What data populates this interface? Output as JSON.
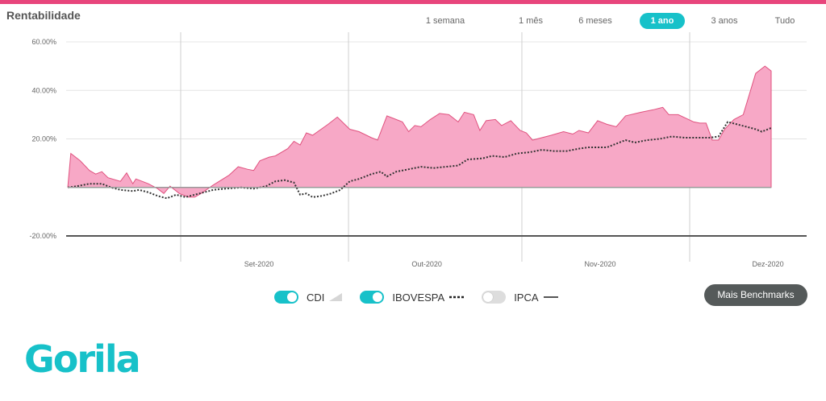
{
  "header": {
    "title": "Rentabilidade"
  },
  "periods": [
    {
      "label": "1 semana",
      "active": false
    },
    {
      "label": "1 mês",
      "active": false
    },
    {
      "label": "6 meses",
      "active": false
    },
    {
      "label": "1 ano",
      "active": true
    },
    {
      "label": "3 anos",
      "active": false
    },
    {
      "label": "Tudo",
      "active": false
    }
  ],
  "legend": {
    "cdi": {
      "label": "CDI",
      "enabled": true
    },
    "ibovespa": {
      "label": "IBOVESPA",
      "enabled": true
    },
    "ipca": {
      "label": "IPCA",
      "enabled": false
    }
  },
  "benchmarks_button": "Mais Benchmarks",
  "logo_text": "Gorila",
  "colors": {
    "accent": "#e8457c",
    "teal": "#17c1c9",
    "area_fill": "#f7a8c6",
    "area_stroke": "#e0527f",
    "dotted": "#333333"
  },
  "chart_data": {
    "type": "area",
    "x_range": [
      "2020-08-18",
      "2020-12-24"
    ],
    "x_ticks": [
      {
        "label": "Set-2020",
        "date": "2020-09-15"
      },
      {
        "label": "Out-2020",
        "date": "2020-10-15"
      },
      {
        "label": "Nov-2020",
        "date": "2020-11-15"
      },
      {
        "label": "Dez-2020",
        "date": "2020-12-15"
      }
    ],
    "ylim": [
      -20,
      60
    ],
    "y_ticks": [
      {
        "value": 60,
        "label": "60.00%"
      },
      {
        "value": 40,
        "label": "40.00%"
      },
      {
        "value": 20,
        "label": "20.00%"
      },
      {
        "value": -20,
        "label": "-20.00%"
      }
    ],
    "gridlines_dates": [
      "2020-09-01",
      "2020-10-01",
      "2020-11-01",
      "2020-12-01"
    ],
    "series": [
      {
        "name": "CDI",
        "style": "area",
        "points": [
          [
            "2020-08-18",
            0
          ],
          [
            "2020-08-19",
            14
          ],
          [
            "2020-08-22",
            11
          ],
          [
            "2020-08-25",
            7
          ],
          [
            "2020-08-27",
            5.5
          ],
          [
            "2020-08-29",
            6.5
          ],
          [
            "2020-08-31",
            4
          ],
          [
            "2020-09-04",
            2.5
          ],
          [
            "2020-09-06",
            6
          ],
          [
            "2020-09-08",
            1.5
          ],
          [
            "2020-09-09",
            3.5
          ],
          [
            "2020-09-13",
            1.5
          ],
          [
            "2020-09-16",
            -0.5
          ],
          [
            "2020-09-18",
            -2.5
          ],
          [
            "2020-09-20",
            0.5
          ],
          [
            "2020-09-23",
            -2.5
          ],
          [
            "2020-09-26",
            -4
          ],
          [
            "2020-09-28",
            -4
          ],
          [
            "2020-09-30",
            -2.5
          ],
          [
            "2020-10-04",
            1
          ],
          [
            "2020-10-09",
            5
          ],
          [
            "2020-10-12",
            8.5
          ],
          [
            "2020-10-15",
            7.5
          ],
          [
            "2020-10-17",
            7
          ],
          [
            "2020-10-19",
            11
          ],
          [
            "2020-10-22",
            12.5
          ],
          [
            "2020-10-24",
            13
          ],
          [
            "2020-10-28",
            16
          ],
          [
            "2020-10-30",
            19
          ],
          [
            "2020-11-01",
            17.5
          ],
          [
            "2020-11-03",
            22.5
          ],
          [
            "2020-11-05",
            21.5
          ],
          [
            "2020-11-10",
            26
          ],
          [
            "2020-11-13",
            29
          ],
          [
            "2020-11-17",
            24
          ],
          [
            "2020-11-20",
            23
          ],
          [
            "2020-11-24",
            20.5
          ],
          [
            "2020-11-26",
            19.5
          ],
          [
            "2020-11-29",
            29.5
          ],
          [
            "2020-12-01",
            28.5
          ],
          [
            "2020-12-04",
            27
          ],
          [
            "2020-12-06",
            23
          ],
          [
            "2020-12-08",
            25.5
          ],
          [
            "2020-12-10",
            25
          ],
          [
            "2020-12-13",
            28
          ],
          [
            "2020-12-16",
            30.5
          ],
          [
            "2020-12-19",
            30
          ],
          [
            "2020-12-22",
            27
          ],
          [
            "2020-12-24",
            31
          ],
          [
            "2020-12-27",
            30
          ],
          [
            "2020-12-29",
            23.5
          ],
          [
            "2020-12-31",
            27.5
          ],
          [
            "2021-01-03",
            28
          ],
          [
            "2021-01-05",
            25.5
          ],
          [
            "2021-01-08",
            27.5
          ],
          [
            "2021-01-11",
            23.5
          ],
          [
            "2021-01-13",
            22.5
          ],
          [
            "2021-01-15",
            19.5
          ],
          [
            "2021-01-18",
            20.5
          ],
          [
            "2021-01-21",
            21.5
          ],
          [
            "2021-01-25",
            23
          ],
          [
            "2021-01-28",
            22
          ],
          [
            "2021-01-30",
            23.5
          ],
          [
            "2021-02-02",
            22.5
          ],
          [
            "2021-02-05",
            27.5
          ],
          [
            "2021-02-08",
            26
          ],
          [
            "2021-02-11",
            25
          ],
          [
            "2021-02-14",
            29.5
          ],
          [
            "2021-02-19",
            31
          ],
          [
            "2021-02-23",
            32
          ],
          [
            "2021-02-26",
            33
          ],
          [
            "2021-02-28",
            30
          ],
          [
            "2021-03-03",
            30
          ],
          [
            "2021-03-08",
            27
          ],
          [
            "2021-03-10",
            26.5
          ],
          [
            "2021-03-12",
            26.5
          ],
          [
            "2021-03-14",
            19.5
          ],
          [
            "2021-03-16",
            19.5
          ],
          [
            "2021-03-18",
            24
          ],
          [
            "2021-03-21",
            28
          ],
          [
            "2021-03-24",
            30
          ],
          [
            "2021-03-28",
            47
          ],
          [
            "2021-03-31",
            50
          ],
          [
            "2021-04-02",
            48
          ]
        ]
      },
      {
        "name": "IBOVESPA",
        "style": "dotted",
        "points": [
          [
            "2020-08-18",
            0
          ],
          [
            "2020-08-21",
            0.5
          ],
          [
            "2020-08-25",
            1.5
          ],
          [
            "2020-08-29",
            1.5
          ],
          [
            "2020-09-01",
            0
          ],
          [
            "2020-09-04",
            -1
          ],
          [
            "2020-09-08",
            -1.5
          ],
          [
            "2020-09-10",
            -1
          ],
          [
            "2020-09-13",
            -2
          ],
          [
            "2020-09-16",
            -3.5
          ],
          [
            "2020-09-19",
            -4.5
          ],
          [
            "2020-09-22",
            -3
          ],
          [
            "2020-09-25",
            -4
          ],
          [
            "2020-09-28",
            -3
          ],
          [
            "2020-10-01",
            -2
          ],
          [
            "2020-10-04",
            -1
          ],
          [
            "2020-10-08",
            -0.5
          ],
          [
            "2020-10-13",
            0
          ],
          [
            "2020-10-17",
            -0.5
          ],
          [
            "2020-10-21",
            0.5
          ],
          [
            "2020-10-24",
            2.5
          ],
          [
            "2020-10-27",
            3
          ],
          [
            "2020-10-30",
            2
          ],
          [
            "2020-11-01",
            -3
          ],
          [
            "2020-11-03",
            -2.5
          ],
          [
            "2020-11-05",
            -4
          ],
          [
            "2020-11-08",
            -3.5
          ],
          [
            "2020-11-11",
            -2.5
          ],
          [
            "2020-11-14",
            -1
          ],
          [
            "2020-11-17",
            2.5
          ],
          [
            "2020-11-20",
            3.5
          ],
          [
            "2020-11-24",
            5.5
          ],
          [
            "2020-11-27",
            6.5
          ],
          [
            "2020-11-29",
            4.5
          ],
          [
            "2020-12-02",
            6.5
          ],
          [
            "2020-12-06",
            7.5
          ],
          [
            "2020-12-10",
            8.5
          ],
          [
            "2020-12-14",
            8
          ],
          [
            "2020-12-18",
            8.5
          ],
          [
            "2020-12-22",
            9
          ],
          [
            "2020-12-25",
            11.5
          ],
          [
            "2020-12-30",
            12
          ],
          [
            "2021-01-02",
            13
          ],
          [
            "2021-01-06",
            12.5
          ],
          [
            "2021-01-10",
            14
          ],
          [
            "2021-01-14",
            14.5
          ],
          [
            "2021-01-18",
            15.5
          ],
          [
            "2021-01-22",
            15
          ],
          [
            "2021-01-26",
            15
          ],
          [
            "2021-01-30",
            16
          ],
          [
            "2021-02-02",
            16.5
          ],
          [
            "2021-02-05",
            16.5
          ],
          [
            "2021-02-08",
            16.5
          ],
          [
            "2021-02-11",
            18
          ],
          [
            "2021-02-14",
            19.5
          ],
          [
            "2021-02-17",
            18.5
          ],
          [
            "2021-02-21",
            19.5
          ],
          [
            "2021-02-25",
            20
          ],
          [
            "2021-03-01",
            21
          ],
          [
            "2021-03-05",
            20.5
          ],
          [
            "2021-03-09",
            20.5
          ],
          [
            "2021-03-13",
            20.5
          ],
          [
            "2021-03-16",
            21
          ],
          [
            "2021-03-19",
            27
          ],
          [
            "2021-03-22",
            26
          ],
          [
            "2021-03-25",
            25
          ],
          [
            "2021-03-28",
            24
          ],
          [
            "2021-03-30",
            23
          ],
          [
            "2021-04-02",
            24.5
          ]
        ]
      }
    ],
    "grid": true,
    "legend_position": "bottom"
  }
}
